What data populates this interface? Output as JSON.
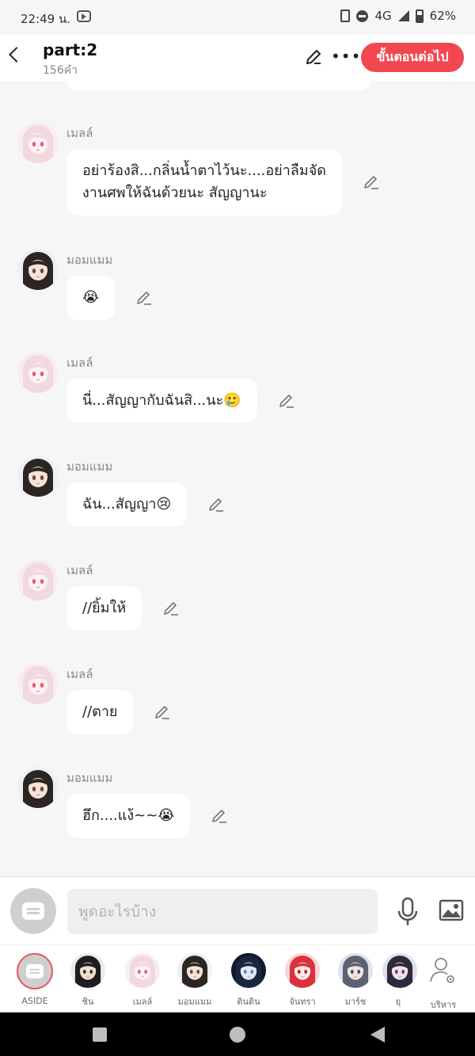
{
  "status_bar": {
    "time": "22:49 น.",
    "network": "4G",
    "battery": "62%"
  },
  "header": {
    "title": "part:2",
    "word_count": "156คำ",
    "next_button": "ขั้นตอนต่อไป"
  },
  "messages": [
    {
      "sender": "เมลล์",
      "avatar": "girl-pink",
      "lines": [
        "อย่าร้องสิ...กลิ่นน้ำตาไว้นะ....อย่าลืมจัด",
        "งานศพให้ฉันด้วยนะ สัญญานะ"
      ]
    },
    {
      "sender": "มอมแมม",
      "avatar": "girl-dark",
      "lines": [
        "😭"
      ]
    },
    {
      "sender": "เมลล์",
      "avatar": "girl-pink",
      "lines": [
        "นี่...สัญญากับฉันสิ...นะ🥲"
      ]
    },
    {
      "sender": "มอมแมม",
      "avatar": "girl-dark",
      "lines": [
        "ฉัน...สัญญา😢"
      ]
    },
    {
      "sender": "เมลล์",
      "avatar": "girl-pink",
      "lines": [
        "//ยิ้มให้"
      ]
    },
    {
      "sender": "เมลล์",
      "avatar": "girl-pink",
      "lines": [
        "//ตาย"
      ]
    },
    {
      "sender": "มอมแมม",
      "avatar": "girl-dark",
      "lines": [
        "ฮึก....แง้~~😭"
      ]
    }
  ],
  "composer": {
    "placeholder": "พูดอะไรบ้าง"
  },
  "characters": [
    {
      "label": "ASIDE",
      "kind": "aside"
    },
    {
      "label": "ชิน",
      "kind": "boy-dark"
    },
    {
      "label": "เมลล์",
      "kind": "girl-pink"
    },
    {
      "label": "มอมแมม",
      "kind": "girl-dark"
    },
    {
      "label": "ตินติน",
      "kind": "boy-blue"
    },
    {
      "label": "จันทรา",
      "kind": "girl-red"
    },
    {
      "label": "มาร์ช",
      "kind": "boy-gray"
    },
    {
      "label": "ยุ",
      "kind": "boy-purple"
    },
    {
      "label": "บริหาร",
      "kind": "admin"
    }
  ],
  "colors": {
    "accent": "#f2474f",
    "bubble": "#ffffff",
    "background": "#f6f6f6"
  }
}
